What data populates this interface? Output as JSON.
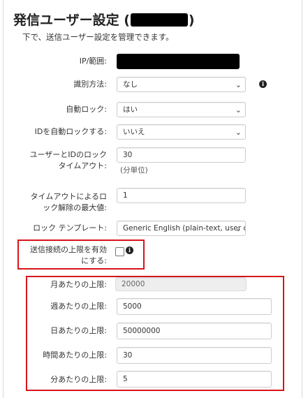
{
  "page": {
    "title": "発信ユーザー設定 (",
    "title_suffix": ")",
    "subtitle": "下で、送信ユーザー設定を管理できます。"
  },
  "fields": {
    "ip_range": {
      "label": "IP/範囲:"
    },
    "identification": {
      "label": "識別方法:",
      "value": "なし"
    },
    "auto_lock": {
      "label": "自動ロック:",
      "value": "はい"
    },
    "auto_lock_id": {
      "label": "IDを自動ロックする:",
      "value": "いいえ"
    },
    "lock_timeout": {
      "label": "ユーザーとIDのロック タイムアウト:",
      "value": "30",
      "hint": "(分単位)"
    },
    "timeout_max": {
      "label": "タイムアウトによるロック解除の最大値:",
      "value": "1"
    },
    "lock_template": {
      "label": "ロック テンプレート:",
      "value": "Generic English (plain-text, user or ident"
    },
    "enable_limit": {
      "label": "送信接続の上限を有効にする:"
    },
    "limit_month": {
      "label": "月あたりの上限:",
      "value": "20000"
    },
    "limit_week": {
      "label": "週あたりの上限:",
      "value": "5000"
    },
    "limit_day": {
      "label": "日あたりの上限:",
      "value": "50000000"
    },
    "limit_hour": {
      "label": "時間あたりの上限:",
      "value": "30"
    },
    "limit_minute": {
      "label": "分あたりの上限:",
      "value": "5"
    }
  },
  "icons": {
    "info": "info-circle-icon",
    "chevron": "chevron-down-icon"
  },
  "colors": {
    "highlight": "#d7141a",
    "redaction": "#000000"
  }
}
